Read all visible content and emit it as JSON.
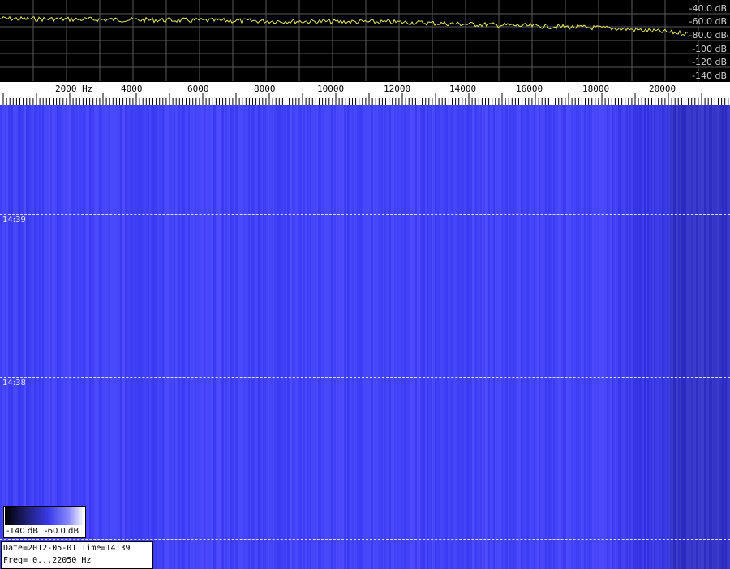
{
  "spectrum": {
    "db_labels": [
      "-40.0 dB",
      "-60.0 dB",
      "-80.0 dB",
      "-100 dB",
      "-120 dB",
      "-140 dB"
    ],
    "trace_color": "#e8e860",
    "grid_color": "#5a5a5a"
  },
  "frequency_axis": {
    "labels": [
      "2000 Hz",
      "4000",
      "6000",
      "8000",
      "10000",
      "12000",
      "14000",
      "16000",
      "18000",
      "20000"
    ]
  },
  "waterfall": {
    "time_markers": [
      "14:39",
      "14:38"
    ],
    "base_color": "#4343f8"
  },
  "colorbar": {
    "min_label": "-140 dB",
    "max_label": "-60.0 dB"
  },
  "info": {
    "line1": "Date=2012-05-01 Time=14:39",
    "line2": "Freq= 0...22050 Hz"
  }
}
